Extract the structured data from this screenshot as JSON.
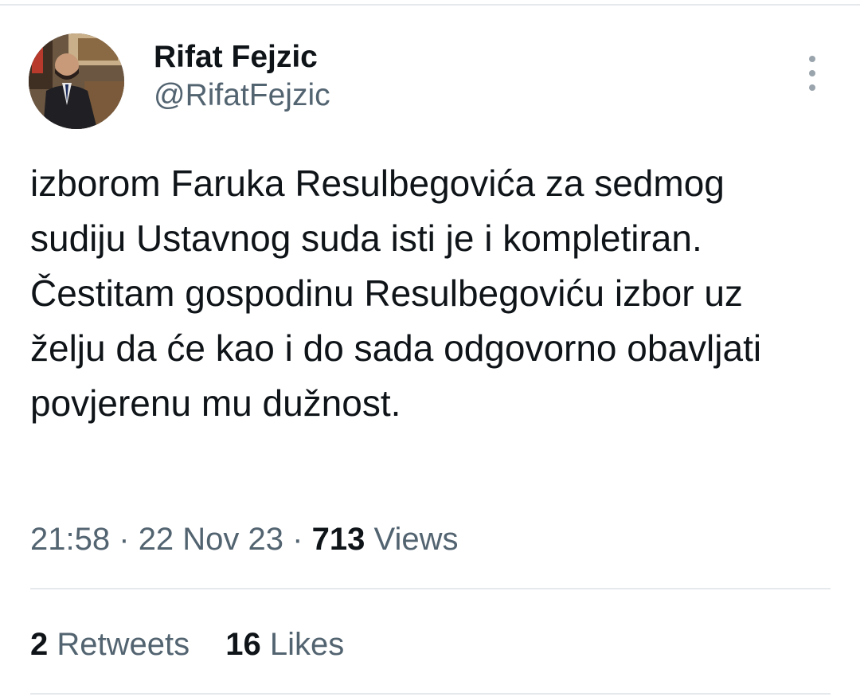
{
  "tweet": {
    "author": {
      "display_name": "Rifat Fejzic",
      "handle": "@RifatFejzic",
      "avatar_icon": "profile-photo"
    },
    "more_icon": "more-vertical-icon",
    "text": "izborom Faruka Resulbegovića za sedmog sudiju Ustavnog suda isti je i kompletiran. Čestitam gospodinu Resulbegoviću izbor uz želju da će kao i do sada odgovorno obavljati povjerenu mu dužnost.",
    "time": "21:58",
    "separator": "·",
    "date": "22 Nov 23",
    "views_count": "713",
    "views_label": "Views",
    "retweets_count": "2",
    "retweets_label": "Retweets",
    "likes_count": "16",
    "likes_label": "Likes"
  },
  "colors": {
    "text_primary": "#0f1419",
    "text_secondary": "#536471",
    "divider": "#e6e9ec"
  }
}
